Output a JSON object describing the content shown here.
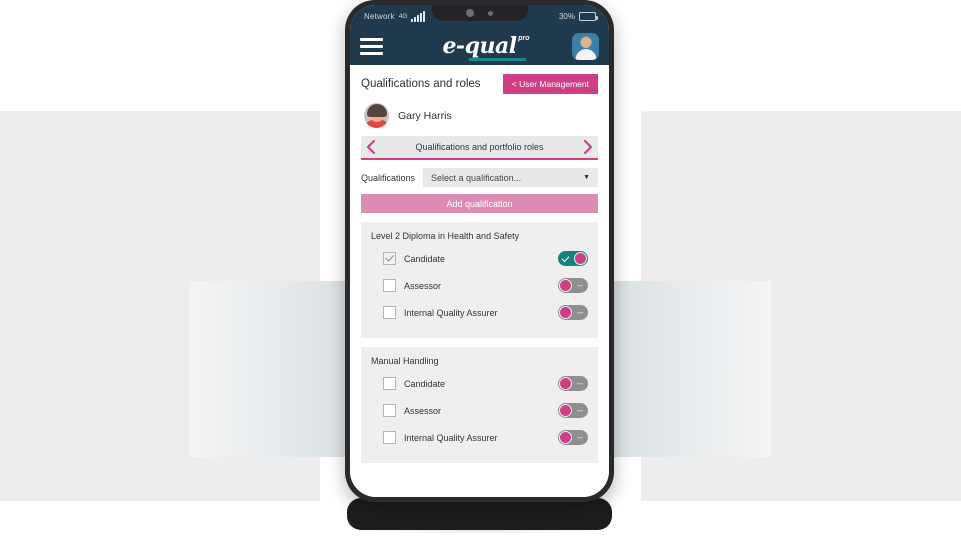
{
  "status_bar": {
    "network_label": "Network",
    "network_type": "4G",
    "signal_icon": "signal-bars-icon",
    "battery_percent": "30%",
    "battery_icon": "battery-icon"
  },
  "app_header": {
    "menu_icon": "hamburger-menu-icon",
    "brand_name": "e-qual",
    "brand_superscript": "pro",
    "avatar_icon": "user-avatar-icon"
  },
  "page": {
    "title": "Qualifications and roles",
    "back_button_label": "< User Management",
    "user": {
      "name": "Gary Harris",
      "avatar_icon": "person-avatar-icon"
    }
  },
  "carousel": {
    "title": "Qualifications and portfolio roles",
    "prev_icon": "chevron-left-icon",
    "next_icon": "chevron-right-icon"
  },
  "picker": {
    "label": "Qualifications",
    "select_value": "Select a qualification...",
    "select_placeholder": "Select a qualification...",
    "caret_icon": "chevron-down-icon",
    "add_button_label": "Add qualification"
  },
  "qualifications": [
    {
      "title": "Level 2 Diploma in Health and Safety",
      "roles": [
        {
          "label": "Candidate",
          "checked": true,
          "toggle": "on"
        },
        {
          "label": "Assessor",
          "checked": false,
          "toggle": "off"
        },
        {
          "label": "Internal Quality Assurer",
          "checked": false,
          "toggle": "off"
        }
      ]
    },
    {
      "title": "Manual Handling",
      "roles": [
        {
          "label": "Candidate",
          "checked": false,
          "toggle": "off"
        },
        {
          "label": "Assessor",
          "checked": false,
          "toggle": "off"
        },
        {
          "label": "Internal Quality Assurer",
          "checked": false,
          "toggle": "off"
        }
      ]
    }
  ],
  "colors": {
    "header_navy": "#1e3a4c",
    "accent_pink": "#cf3f86",
    "accent_pink_light": "#dd8cb5",
    "accent_teal": "#14827f",
    "panel_grey": "#efefef",
    "background_grey": "#ededed"
  }
}
